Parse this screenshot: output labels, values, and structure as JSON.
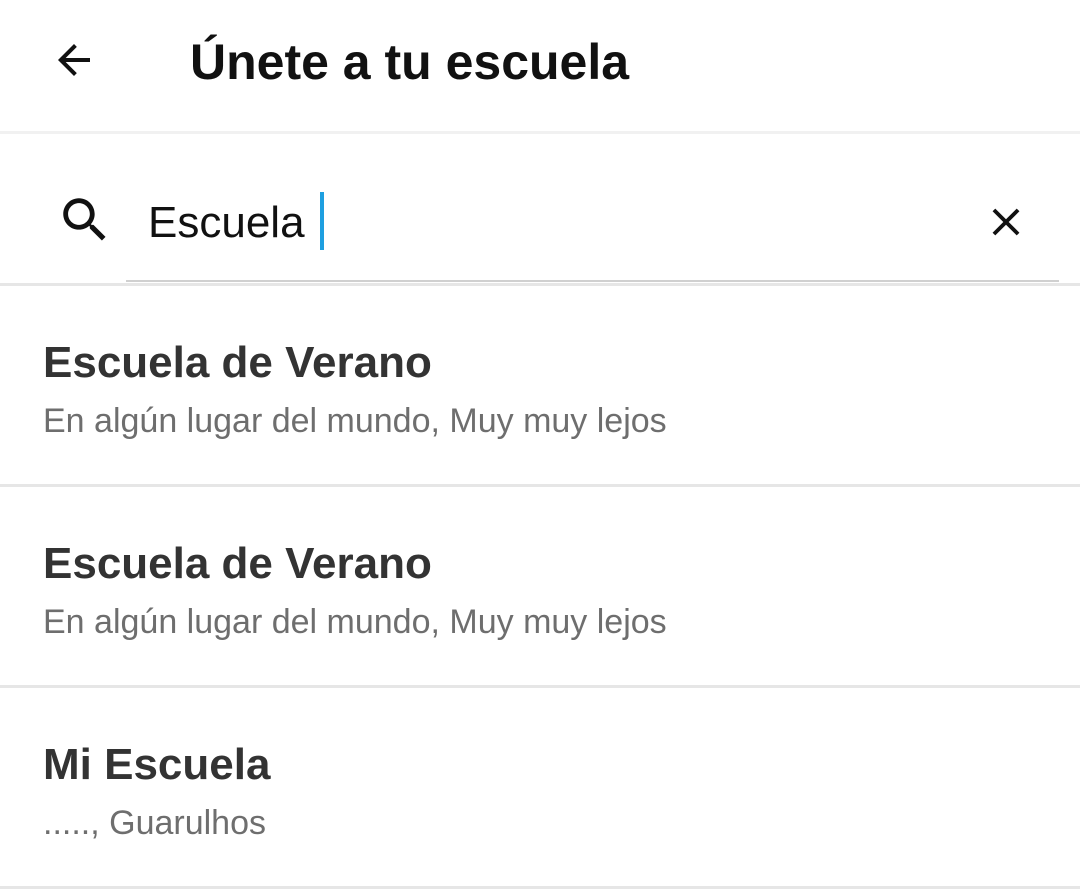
{
  "app_bar": {
    "title": "Únete a tu escuela",
    "back_icon": "arrow-left-icon"
  },
  "search": {
    "value": "Escuela",
    "search_icon": "search-icon",
    "clear_icon": "close-icon",
    "caret_color": "#1e9fe0"
  },
  "results": [
    {
      "name": "Escuela de Verano",
      "location": "En algún lugar del mundo, Muy muy lejos"
    },
    {
      "name": "Escuela de Verano",
      "location": "En algún lugar del mundo, Muy muy lejos"
    },
    {
      "name": "Mi Escuela",
      "location": "....., Guarulhos"
    }
  ]
}
